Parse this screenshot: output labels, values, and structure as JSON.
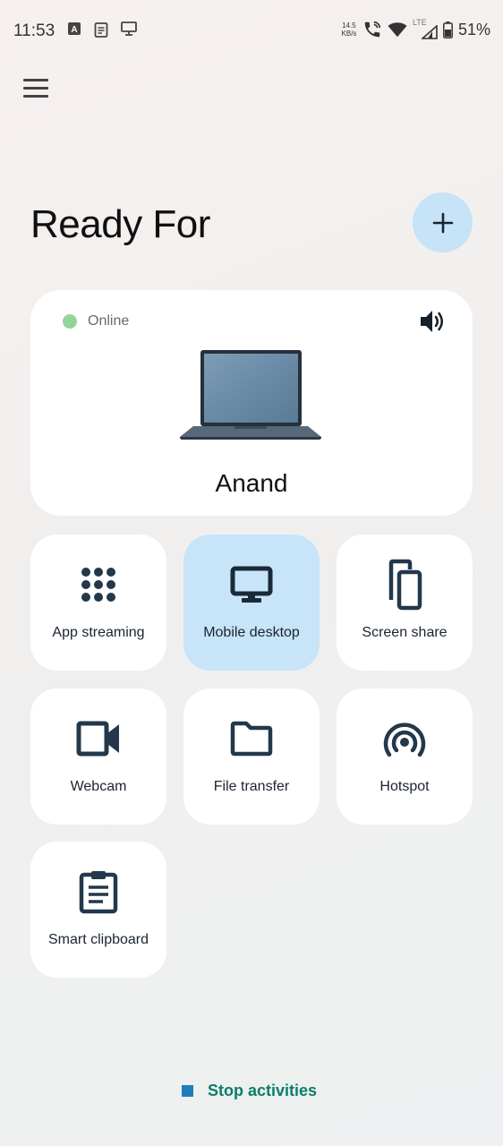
{
  "status_bar": {
    "time": "11:53",
    "net_speed_value": "14.5",
    "net_speed_unit": "KB/s",
    "network_type": "LTE",
    "battery": "51%"
  },
  "page": {
    "title": "Ready For"
  },
  "device": {
    "status": "Online",
    "status_color": "#93d49a",
    "name": "Anand"
  },
  "features": [
    {
      "label": "App streaming",
      "icon": "grid-dots-icon",
      "active": false
    },
    {
      "label": "Mobile desktop",
      "icon": "monitor-icon",
      "active": true
    },
    {
      "label": "Screen share",
      "icon": "phones-icon",
      "active": false
    },
    {
      "label": "Webcam",
      "icon": "video-camera-icon",
      "active": false
    },
    {
      "label": "File transfer",
      "icon": "folder-icon",
      "active": false
    },
    {
      "label": "Hotspot",
      "icon": "hotspot-icon",
      "active": false
    },
    {
      "label": "Smart clipboard",
      "icon": "clipboard-icon",
      "active": false
    }
  ],
  "footer": {
    "stop_label": "Stop activities"
  },
  "colors": {
    "accent_light": "#c7e4f9",
    "icon_dark": "#23384a",
    "stop_text": "#0a7d6d",
    "stop_square": "#1d7fb8"
  }
}
